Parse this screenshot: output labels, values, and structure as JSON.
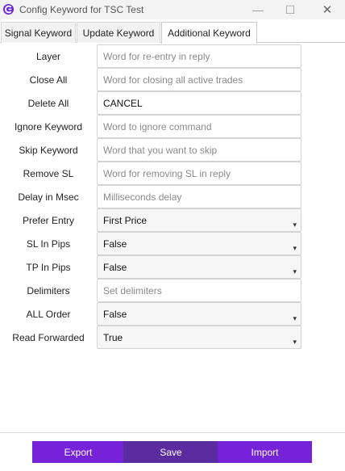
{
  "window": {
    "title": "Config Keyword for TSC Test",
    "minimize_glyph": "—",
    "maximize_glyph": "☐",
    "close_glyph": "✕",
    "icon": "tsc-logo-icon"
  },
  "tabs": [
    {
      "label": "Signal Keyword",
      "active": false
    },
    {
      "label": "Update Keyword",
      "active": false
    },
    {
      "label": "Additional Keyword",
      "active": true
    }
  ],
  "form": {
    "rows": [
      {
        "label": "Layer",
        "type": "text",
        "value": "",
        "placeholder": "Word for re-entry in reply"
      },
      {
        "label": "Close All",
        "type": "text",
        "value": "",
        "placeholder": "Word for closing all active trades"
      },
      {
        "label": "Delete All",
        "type": "text",
        "value": "CANCEL",
        "placeholder": ""
      },
      {
        "label": "Ignore Keyword",
        "type": "text",
        "value": "",
        "placeholder": "Word to ignore command"
      },
      {
        "label": "Skip Keyword",
        "type": "text",
        "value": "",
        "placeholder": "Word that you want to skip"
      },
      {
        "label": "Remove SL",
        "type": "text",
        "value": "",
        "placeholder": "Word for removing SL in reply"
      },
      {
        "label": "Delay in Msec",
        "type": "text",
        "value": "",
        "placeholder": "Milliseconds delay"
      },
      {
        "label": "Prefer Entry",
        "type": "select",
        "value": "First Price"
      },
      {
        "label": "SL In Pips",
        "type": "select",
        "value": "False"
      },
      {
        "label": "TP In Pips",
        "type": "select",
        "value": "False"
      },
      {
        "label": "Delimiters",
        "type": "text",
        "value": "",
        "placeholder": "Set delimiters"
      },
      {
        "label": "ALL Order",
        "type": "select",
        "value": "False"
      },
      {
        "label": "Read Forwarded",
        "type": "select",
        "value": "True"
      }
    ],
    "dropdown_caret": "▾"
  },
  "buttons": {
    "export": "Export",
    "save": "Save",
    "import": "Import"
  },
  "colors": {
    "accent": "#7622d8",
    "save_button": "#5a2ca0",
    "logo": "#6a2bd6"
  }
}
